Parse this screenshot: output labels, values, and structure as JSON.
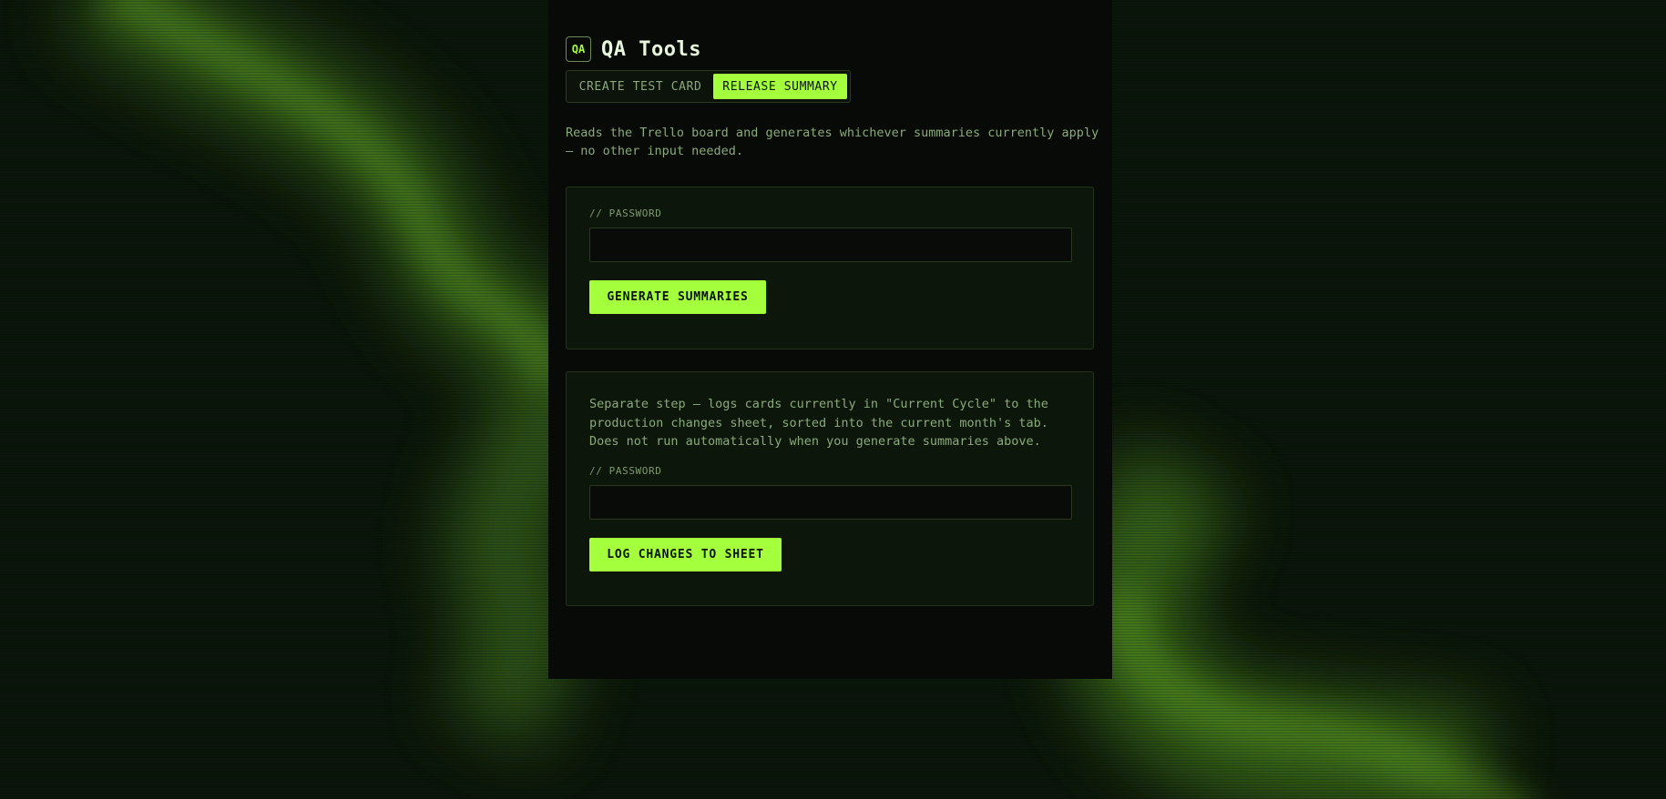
{
  "app": {
    "logo_text": "QA",
    "title": "QA Tools"
  },
  "tabs": [
    {
      "label": "CREATE TEST CARD",
      "active": false
    },
    {
      "label": "RELEASE SUMMARY",
      "active": true
    }
  ],
  "intro": "Reads the Trello board and generates whichever summaries currently apply — no other input needed.",
  "summary_card": {
    "password_label": "// PASSWORD",
    "password_value": "",
    "button_label": "GENERATE SUMMARIES"
  },
  "log_card": {
    "description": "Separate step — logs cards currently in \"Current Cycle\" to the production changes sheet, sorted into the current month's tab. Does not run automatically when you generate summaries above.",
    "password_label": "// PASSWORD",
    "password_value": "",
    "button_label": "LOG CHANGES TO SHEET"
  },
  "colors": {
    "accent": "#a4ff3c",
    "background": "#0a1409",
    "panel": "#070a06",
    "text_muted": "#8aab78"
  }
}
